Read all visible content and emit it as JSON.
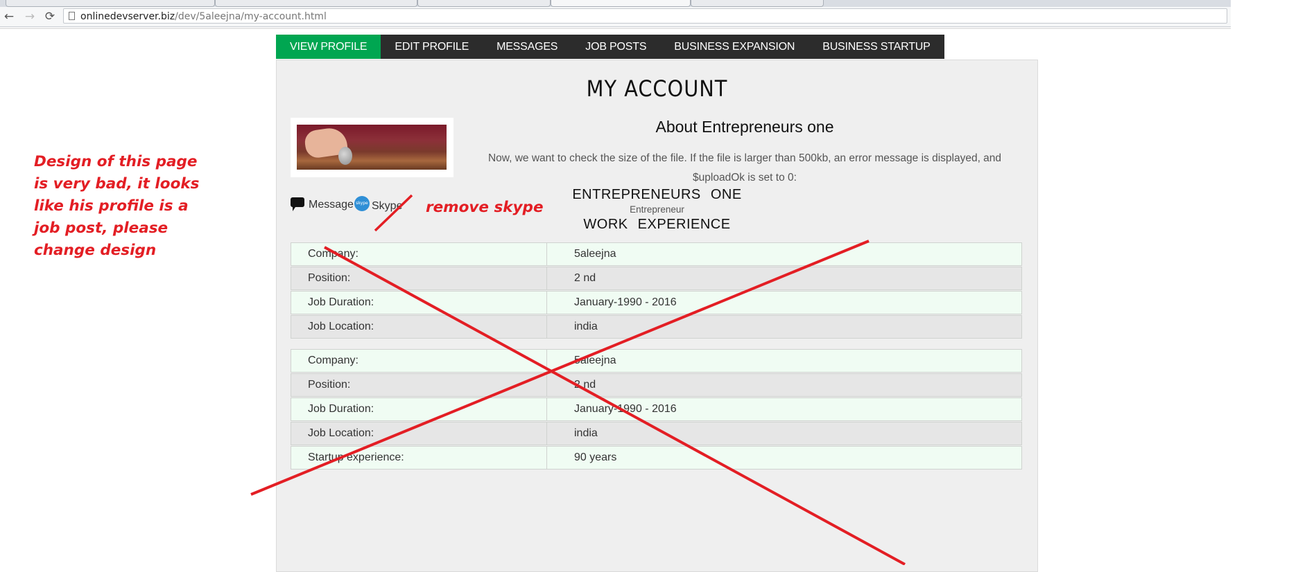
{
  "browser": {
    "url_host": "onlinedevserver.biz",
    "url_path": "/dev/5aleejna/my-account.html",
    "back_icon": "back-arrow-icon",
    "forward_icon": "forward-arrow-icon",
    "reload_icon": "reload-icon"
  },
  "nav": {
    "items": [
      {
        "label": "VIEW PROFILE",
        "active": true
      },
      {
        "label": "EDIT PROFILE",
        "active": false
      },
      {
        "label": "MESSAGES",
        "active": false
      },
      {
        "label": "JOB POSTS",
        "active": false
      },
      {
        "label": "BUSINESS EXPANSION",
        "active": false
      },
      {
        "label": "BUSINESS STARTUP",
        "active": false
      }
    ],
    "active_color": "#00a651",
    "bar_color": "#2c2c2c"
  },
  "account": {
    "title": "MY  ACCOUNT",
    "about_heading": "About Entrepreneurs one",
    "about_text": "Now, we want to check the size of the file. If the file is larger than 500kb, an error message is displayed, and $uploadOk is set to 0:",
    "message_label": "Message",
    "skype_label": "Skype",
    "skype_icon_text": "skype",
    "name": "ENTREPRENEURS   ONE",
    "role": "Entrepreneur",
    "experience_heading": "WORK   EXPERIENCE"
  },
  "experience": [
    {
      "label": "Company:",
      "value": "5aleejna"
    },
    {
      "label": "Position:",
      "value": "2 nd"
    },
    {
      "label": "Job Duration:",
      "value": "January-1990 - 2016"
    },
    {
      "label": "Job Location:",
      "value": "india"
    }
  ],
  "experience2": [
    {
      "label": "Company:",
      "value": "5aleejna"
    },
    {
      "label": "Position:",
      "value": "2 nd"
    },
    {
      "label": "Job Duration:",
      "value": "January-1990 - 2016"
    },
    {
      "label": "Job Location:",
      "value": "india"
    },
    {
      "label": "Startup experience:",
      "value": "90 years"
    }
  ],
  "annotations": {
    "design_note": [
      "Design of this page",
      "is very bad, it looks",
      "like his profile is a",
      "job post, please",
      "change design"
    ],
    "skype_note": "remove skype",
    "color": "#e31e24"
  }
}
